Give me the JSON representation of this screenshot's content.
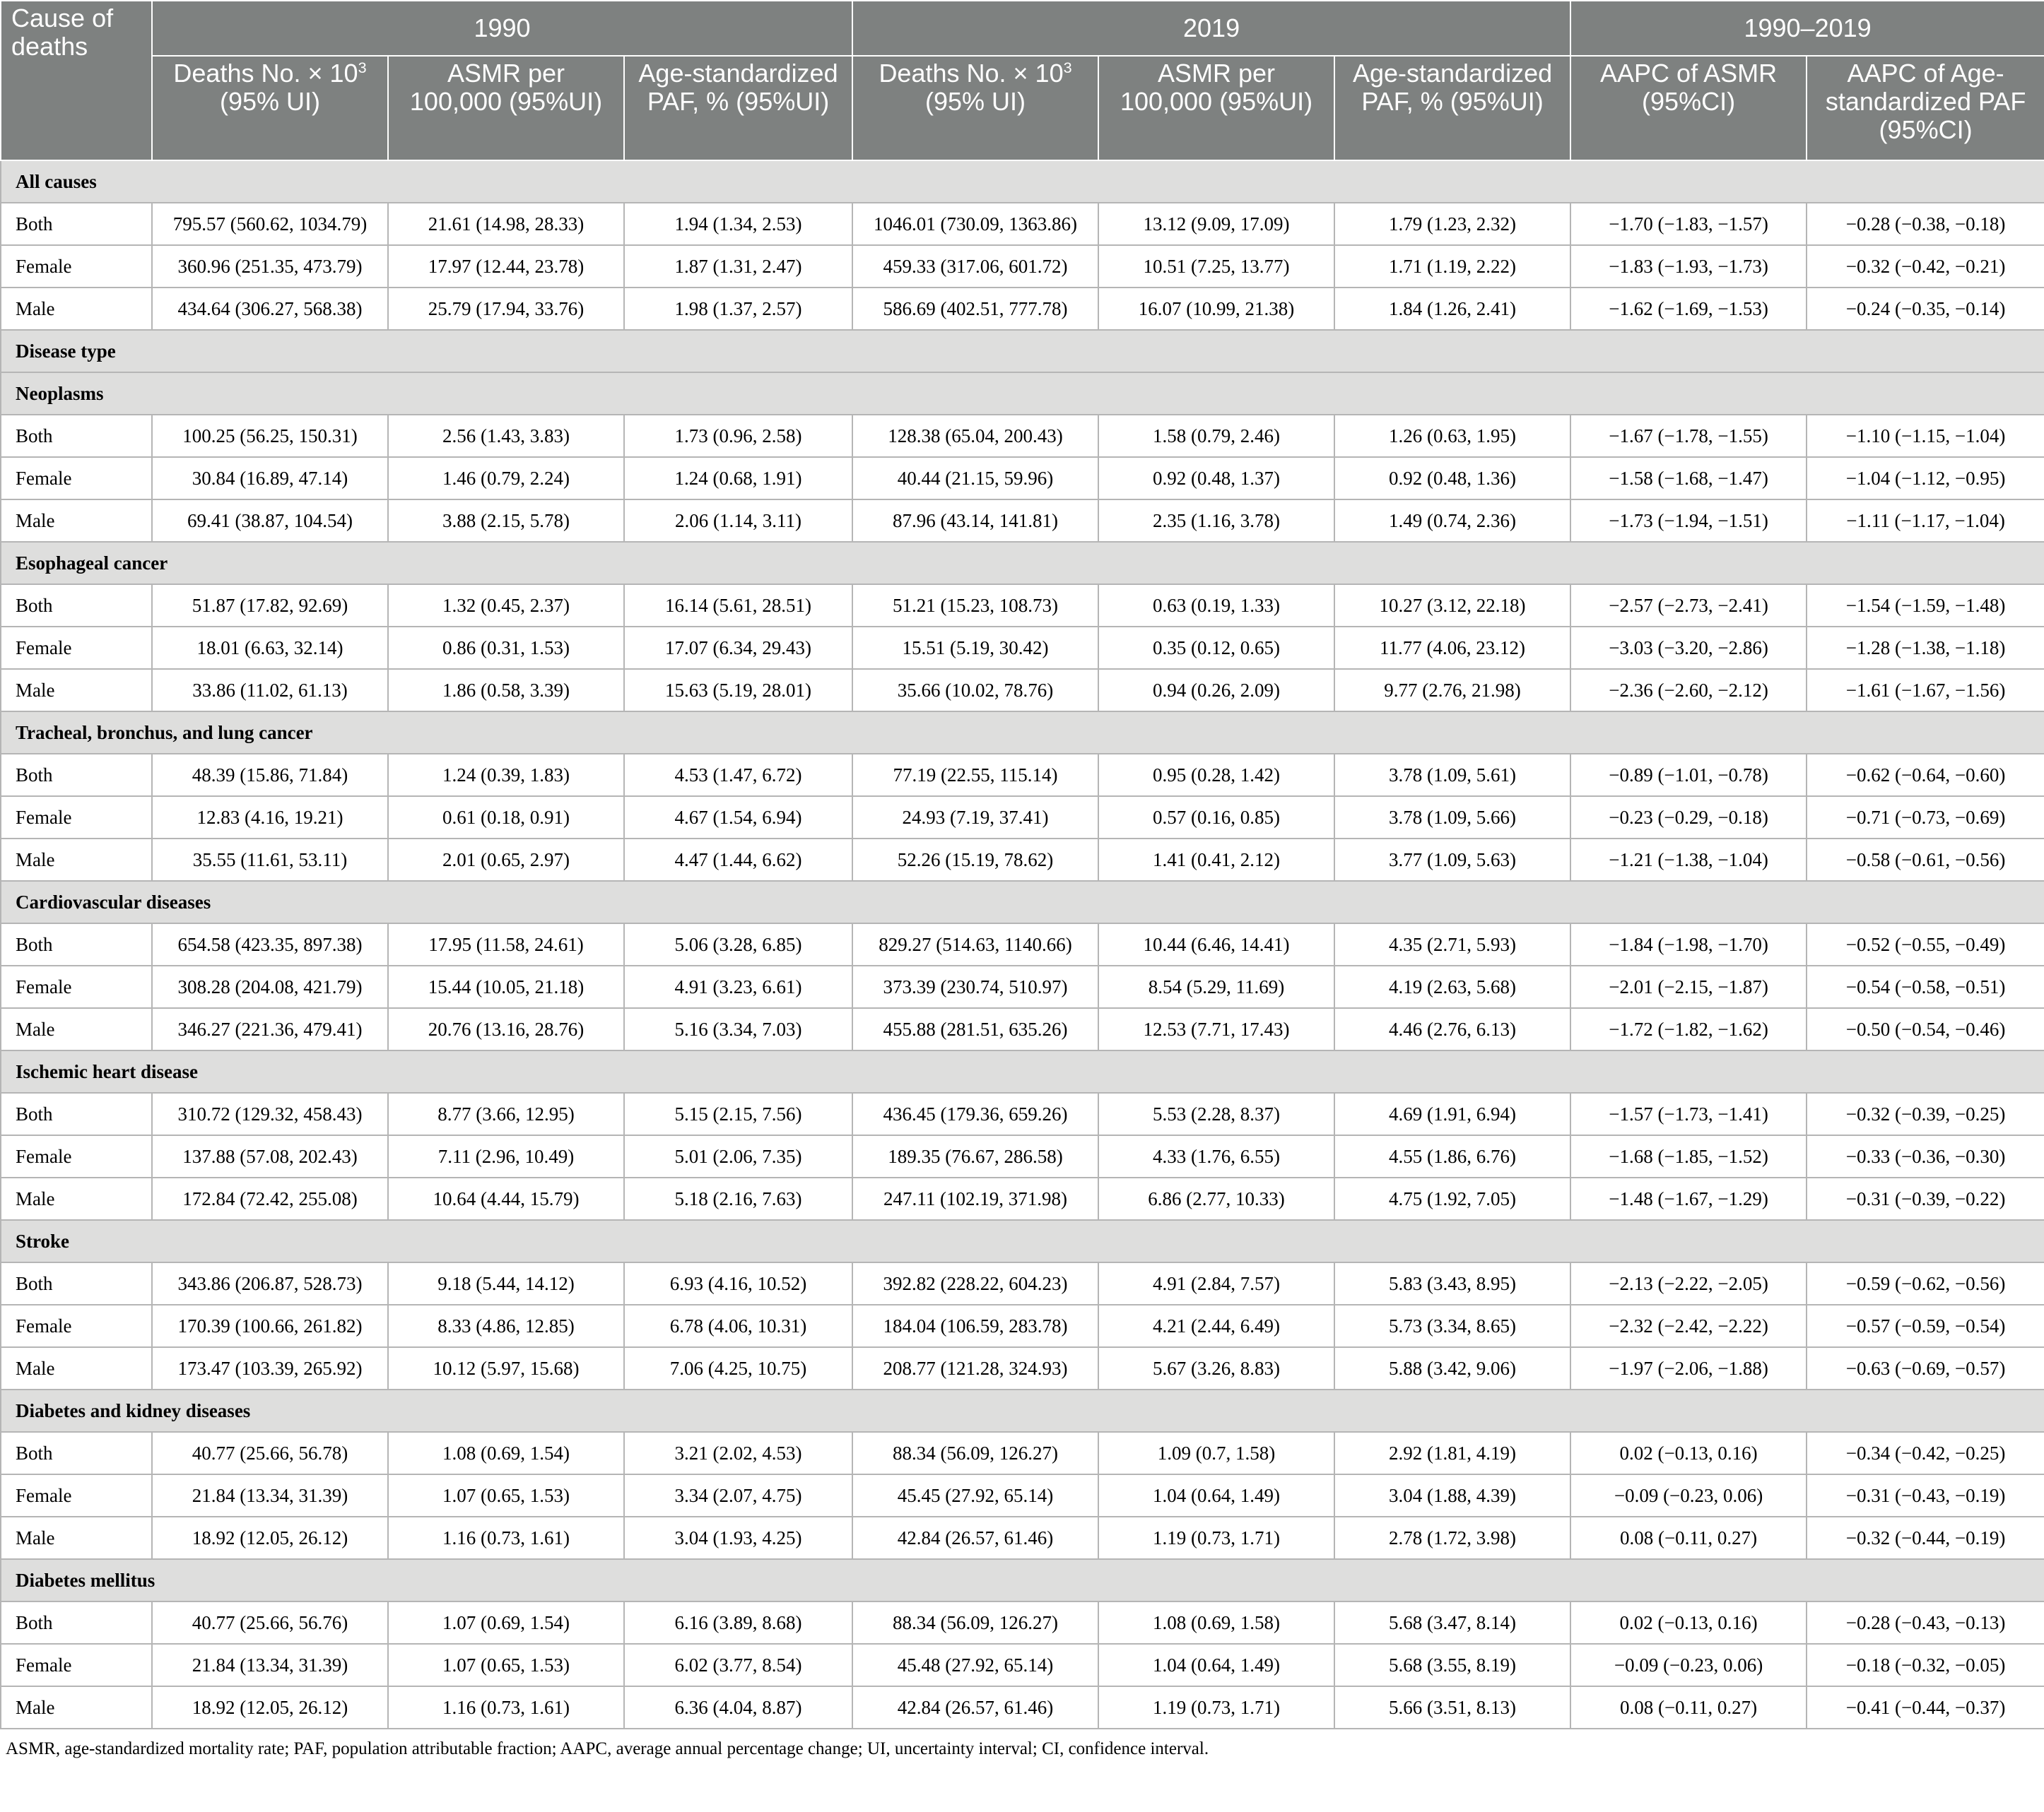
{
  "header": {
    "cause": "Cause of deaths",
    "years": [
      "1990",
      "2019",
      "1990–2019"
    ],
    "subheaders": [
      {
        "text": "Deaths No. × 10",
        "sup": "3",
        "text2": "(95% UI)"
      },
      {
        "text": "ASMR per 100,000 (95%UI)"
      },
      {
        "text": "Age-standardized PAF, % (95%UI)"
      },
      {
        "text": "Deaths No. × 10",
        "sup": "3",
        "text2": "(95% UI)"
      },
      {
        "text": "ASMR per 100,000 (95%UI)"
      },
      {
        "text": "Age-standardized PAF, % (95%UI)"
      },
      {
        "text": "AAPC of ASMR (95%CI)"
      },
      {
        "text": "AAPC of Age-standardized PAF (95%CI)"
      }
    ]
  },
  "rows": [
    {
      "section": "All causes"
    },
    {
      "label": "Both",
      "cells": [
        "795.57 (560.62, 1034.79)",
        "21.61 (14.98, 28.33)",
        "1.94 (1.34, 2.53)",
        "1046.01 (730.09, 1363.86)",
        "13.12 (9.09, 17.09)",
        "1.79 (1.23, 2.32)",
        "−1.70 (−1.83, −1.57)",
        "−0.28 (−0.38, −0.18)"
      ]
    },
    {
      "label": "Female",
      "cells": [
        "360.96 (251.35, 473.79)",
        "17.97 (12.44, 23.78)",
        "1.87 (1.31, 2.47)",
        "459.33 (317.06, 601.72)",
        "10.51 (7.25, 13.77)",
        "1.71 (1.19, 2.22)",
        "−1.83 (−1.93, −1.73)",
        "−0.32 (−0.42, −0.21)"
      ]
    },
    {
      "label": "Male",
      "cells": [
        "434.64 (306.27, 568.38)",
        "25.79 (17.94, 33.76)",
        "1.98 (1.37, 2.57)",
        "586.69 (402.51, 777.78)",
        "16.07 (10.99, 21.38)",
        "1.84 (1.26, 2.41)",
        "−1.62 (−1.69, −1.53)",
        "−0.24 (−0.35, −0.14)"
      ]
    },
    {
      "section": "Disease type"
    },
    {
      "section": "Neoplasms"
    },
    {
      "label": "Both",
      "cells": [
        "100.25 (56.25, 150.31)",
        "2.56 (1.43, 3.83)",
        "1.73 (0.96, 2.58)",
        "128.38 (65.04, 200.43)",
        "1.58 (0.79, 2.46)",
        "1.26 (0.63, 1.95)",
        "−1.67 (−1.78, −1.55)",
        "−1.10 (−1.15, −1.04)"
      ]
    },
    {
      "label": "Female",
      "cells": [
        "30.84 (16.89, 47.14)",
        "1.46 (0.79, 2.24)",
        "1.24 (0.68, 1.91)",
        "40.44 (21.15, 59.96)",
        "0.92 (0.48, 1.37)",
        "0.92 (0.48, 1.36)",
        "−1.58 (−1.68, −1.47)",
        "−1.04 (−1.12, −0.95)"
      ]
    },
    {
      "label": "Male",
      "cells": [
        "69.41 (38.87, 104.54)",
        "3.88 (2.15, 5.78)",
        "2.06 (1.14, 3.11)",
        "87.96 (43.14, 141.81)",
        "2.35 (1.16, 3.78)",
        "1.49 (0.74, 2.36)",
        "−1.73 (−1.94, −1.51)",
        "−1.11 (−1.17, −1.04)"
      ]
    },
    {
      "section": "Esophageal cancer"
    },
    {
      "label": "Both",
      "cells": [
        "51.87 (17.82, 92.69)",
        "1.32 (0.45, 2.37)",
        "16.14 (5.61, 28.51)",
        "51.21 (15.23, 108.73)",
        "0.63 (0.19, 1.33)",
        "10.27 (3.12, 22.18)",
        "−2.57 (−2.73, −2.41)",
        "−1.54 (−1.59, −1.48)"
      ]
    },
    {
      "label": "Female",
      "cells": [
        "18.01 (6.63, 32.14)",
        "0.86 (0.31, 1.53)",
        "17.07 (6.34, 29.43)",
        "15.51 (5.19, 30.42)",
        "0.35 (0.12, 0.65)",
        "11.77 (4.06, 23.12)",
        "−3.03 (−3.20, −2.86)",
        "−1.28 (−1.38, −1.18)"
      ]
    },
    {
      "label": "Male",
      "cells": [
        "33.86 (11.02, 61.13)",
        "1.86 (0.58, 3.39)",
        "15.63 (5.19, 28.01)",
        "35.66 (10.02, 78.76)",
        "0.94 (0.26, 2.09)",
        "9.77 (2.76, 21.98)",
        "−2.36 (−2.60, −2.12)",
        "−1.61 (−1.67, −1.56)"
      ]
    },
    {
      "section": "Tracheal, bronchus, and lung cancer"
    },
    {
      "label": "Both",
      "cells": [
        "48.39 (15.86, 71.84)",
        "1.24 (0.39, 1.83)",
        "4.53 (1.47, 6.72)",
        "77.19 (22.55, 115.14)",
        "0.95 (0.28, 1.42)",
        "3.78 (1.09, 5.61)",
        "−0.89 (−1.01, −0.78)",
        "−0.62 (−0.64, −0.60)"
      ]
    },
    {
      "label": "Female",
      "cells": [
        "12.83 (4.16, 19.21)",
        "0.61 (0.18, 0.91)",
        "4.67 (1.54, 6.94)",
        "24.93 (7.19, 37.41)",
        "0.57 (0.16, 0.85)",
        "3.78 (1.09, 5.66)",
        "−0.23 (−0.29, −0.18)",
        "−0.71 (−0.73, −0.69)"
      ]
    },
    {
      "label": "Male",
      "cells": [
        "35.55 (11.61, 53.11)",
        "2.01 (0.65, 2.97)",
        "4.47 (1.44, 6.62)",
        "52.26 (15.19, 78.62)",
        "1.41 (0.41, 2.12)",
        "3.77 (1.09, 5.63)",
        "−1.21 (−1.38, −1.04)",
        "−0.58 (−0.61, −0.56)"
      ]
    },
    {
      "section": "Cardiovascular diseases"
    },
    {
      "label": "Both",
      "cells": [
        "654.58 (423.35, 897.38)",
        "17.95 (11.58, 24.61)",
        "5.06 (3.28, 6.85)",
        "829.27 (514.63, 1140.66)",
        "10.44 (6.46, 14.41)",
        "4.35 (2.71, 5.93)",
        "−1.84 (−1.98, −1.70)",
        "−0.52 (−0.55, −0.49)"
      ]
    },
    {
      "label": "Female",
      "cells": [
        "308.28 (204.08, 421.79)",
        "15.44 (10.05, 21.18)",
        "4.91 (3.23, 6.61)",
        "373.39 (230.74, 510.97)",
        "8.54 (5.29, 11.69)",
        "4.19 (2.63, 5.68)",
        "−2.01 (−2.15, −1.87)",
        "−0.54 (−0.58, −0.51)"
      ]
    },
    {
      "label": "Male",
      "cells": [
        "346.27 (221.36, 479.41)",
        "20.76 (13.16, 28.76)",
        "5.16 (3.34, 7.03)",
        "455.88 (281.51, 635.26)",
        "12.53 (7.71, 17.43)",
        "4.46 (2.76, 6.13)",
        "−1.72 (−1.82, −1.62)",
        "−0.50 (−0.54, −0.46)"
      ]
    },
    {
      "section": "Ischemic heart disease"
    },
    {
      "label": "Both",
      "cells": [
        "310.72 (129.32, 458.43)",
        "8.77 (3.66, 12.95)",
        "5.15 (2.15, 7.56)",
        "436.45 (179.36, 659.26)",
        "5.53 (2.28, 8.37)",
        "4.69 (1.91, 6.94)",
        "−1.57 (−1.73, −1.41)",
        "−0.32 (−0.39, −0.25)"
      ]
    },
    {
      "label": "Female",
      "cells": [
        "137.88 (57.08, 202.43)",
        "7.11 (2.96, 10.49)",
        "5.01 (2.06, 7.35)",
        "189.35 (76.67, 286.58)",
        "4.33 (1.76, 6.55)",
        "4.55 (1.86, 6.76)",
        "−1.68 (−1.85, −1.52)",
        "−0.33 (−0.36, −0.30)"
      ]
    },
    {
      "label": "Male",
      "cells": [
        "172.84 (72.42, 255.08)",
        "10.64 (4.44, 15.79)",
        "5.18 (2.16, 7.63)",
        "247.11 (102.19, 371.98)",
        "6.86 (2.77, 10.33)",
        "4.75 (1.92, 7.05)",
        "−1.48 (−1.67, −1.29)",
        "−0.31 (−0.39, −0.22)"
      ]
    },
    {
      "section": "Stroke"
    },
    {
      "label": "Both",
      "cells": [
        "343.86 (206.87, 528.73)",
        "9.18 (5.44, 14.12)",
        "6.93 (4.16, 10.52)",
        "392.82 (228.22, 604.23)",
        "4.91 (2.84, 7.57)",
        "5.83 (3.43, 8.95)",
        "−2.13 (−2.22, −2.05)",
        "−0.59 (−0.62, −0.56)"
      ]
    },
    {
      "label": "Female",
      "cells": [
        "170.39 (100.66, 261.82)",
        "8.33 (4.86, 12.85)",
        "6.78 (4.06, 10.31)",
        "184.04 (106.59, 283.78)",
        "4.21 (2.44, 6.49)",
        "5.73 (3.34, 8.65)",
        "−2.32 (−2.42, −2.22)",
        "−0.57 (−0.59, −0.54)"
      ]
    },
    {
      "label": "Male",
      "cells": [
        "173.47 (103.39, 265.92)",
        "10.12 (5.97, 15.68)",
        "7.06 (4.25, 10.75)",
        "208.77 (121.28, 324.93)",
        "5.67 (3.26, 8.83)",
        "5.88 (3.42, 9.06)",
        "−1.97 (−2.06, −1.88)",
        "−0.63 (−0.69, −0.57)"
      ]
    },
    {
      "section": "Diabetes and kidney diseases"
    },
    {
      "label": "Both",
      "cells": [
        "40.77 (25.66, 56.78)",
        "1.08 (0.69, 1.54)",
        "3.21 (2.02, 4.53)",
        "88.34 (56.09, 126.27)",
        "1.09 (0.7, 1.58)",
        "2.92 (1.81, 4.19)",
        "0.02 (−0.13, 0.16)",
        "−0.34 (−0.42, −0.25)"
      ]
    },
    {
      "label": "Female",
      "cells": [
        "21.84 (13.34, 31.39)",
        "1.07 (0.65, 1.53)",
        "3.34 (2.07, 4.75)",
        "45.45 (27.92, 65.14)",
        "1.04 (0.64, 1.49)",
        "3.04 (1.88, 4.39)",
        "−0.09 (−0.23, 0.06)",
        "−0.31 (−0.43, −0.19)"
      ]
    },
    {
      "label": "Male",
      "cells": [
        "18.92 (12.05, 26.12)",
        "1.16 (0.73, 1.61)",
        "3.04 (1.93, 4.25)",
        "42.84 (26.57, 61.46)",
        "1.19 (0.73, 1.71)",
        "2.78 (1.72, 3.98)",
        "0.08 (−0.11, 0.27)",
        "−0.32 (−0.44, −0.19)"
      ]
    },
    {
      "section": "Diabetes mellitus"
    },
    {
      "label": "Both",
      "cells": [
        "40.77 (25.66, 56.76)",
        "1.07 (0.69, 1.54)",
        "6.16 (3.89, 8.68)",
        "88.34 (56.09, 126.27)",
        "1.08 (0.69, 1.58)",
        "5.68 (3.47, 8.14)",
        "0.02 (−0.13, 0.16)",
        "−0.28 (−0.43, −0.13)"
      ]
    },
    {
      "label": "Female",
      "cells": [
        "21.84 (13.34, 31.39)",
        "1.07 (0.65, 1.53)",
        "6.02 (3.77, 8.54)",
        "45.48 (27.92, 65.14)",
        "1.04 (0.64, 1.49)",
        "5.68 (3.55, 8.19)",
        "−0.09 (−0.23, 0.06)",
        "−0.18 (−0.32, −0.05)"
      ]
    },
    {
      "label": "Male",
      "cells": [
        "18.92 (12.05, 26.12)",
        "1.16 (0.73, 1.61)",
        "6.36 (4.04, 8.87)",
        "42.84 (26.57, 61.46)",
        "1.19 (0.73, 1.71)",
        "5.66 (3.51, 8.13)",
        "0.08 (−0.11, 0.27)",
        "−0.41 (−0.44, −0.37)"
      ]
    }
  ],
  "footnote": "ASMR, age-standardized mortality rate; PAF, population attributable fraction; AAPC, average annual percentage change; UI, uncertainty interval; CI, confidence interval."
}
